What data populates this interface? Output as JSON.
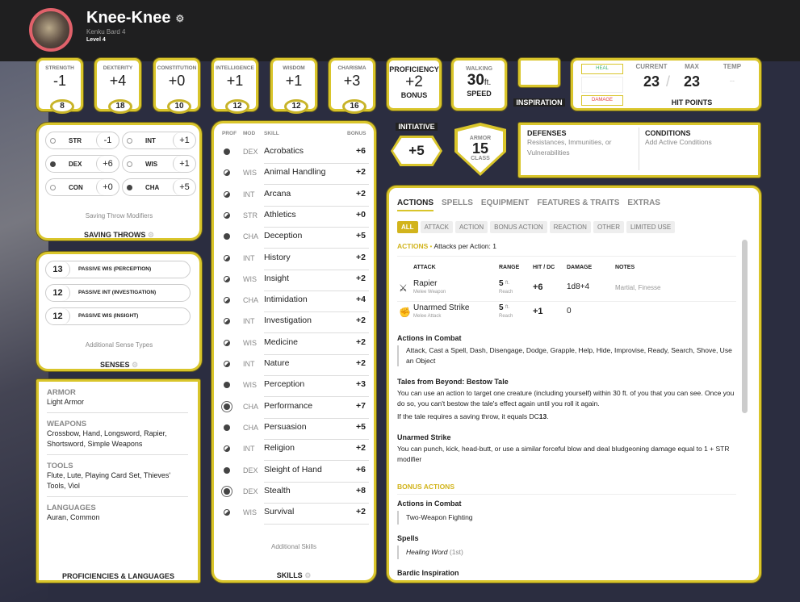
{
  "character": {
    "name": "Knee-Knee",
    "race_class": "Kenku  Bard 4",
    "level": "Level 4"
  },
  "abilities": [
    {
      "label": "STRENGTH",
      "mod": "-1",
      "score": "8"
    },
    {
      "label": "DEXTERITY",
      "mod": "+4",
      "score": "18"
    },
    {
      "label": "CONSTITUTION",
      "mod": "+0",
      "score": "10"
    },
    {
      "label": "INTELLIGENCE",
      "mod": "+1",
      "score": "12"
    },
    {
      "label": "WISDOM",
      "mod": "+1",
      "score": "12"
    },
    {
      "label": "CHARISMA",
      "mod": "+3",
      "score": "16"
    }
  ],
  "proficiency": {
    "top": "PROFICIENCY",
    "value": "+2",
    "bottom": "BONUS"
  },
  "speed": {
    "top": "WALKING",
    "value": "30",
    "unit": "ft.",
    "bottom": "SPEED"
  },
  "inspiration": {
    "label": "INSPIRATION"
  },
  "hp": {
    "heal": "HEAL",
    "damage": "DAMAGE",
    "current_label": "CURRENT",
    "max_label": "MAX",
    "temp_label": "TEMP",
    "current": "23",
    "sep": "/",
    "max": "23",
    "temp": "--",
    "title": "HIT POINTS"
  },
  "initiative": {
    "label": "INITIATIVE",
    "value": "+5"
  },
  "armor": {
    "top": "ARMOR",
    "value": "15",
    "bottom": "CLASS"
  },
  "defenses": {
    "title": "DEFENSES",
    "text": "Resistances, Immunities, or Vulnerabilities"
  },
  "conditions": {
    "title": "CONDITIONS",
    "text": "Add Active Conditions"
  },
  "saving_throws": {
    "title": "SAVING THROWS",
    "note": "Saving Throw Modifiers",
    "items": [
      {
        "ab": "STR",
        "v": "-1",
        "prof": false
      },
      {
        "ab": "INT",
        "v": "+1",
        "prof": false
      },
      {
        "ab": "DEX",
        "v": "+6",
        "prof": true
      },
      {
        "ab": "WIS",
        "v": "+1",
        "prof": false
      },
      {
        "ab": "CON",
        "v": "+0",
        "prof": false
      },
      {
        "ab": "CHA",
        "v": "+5",
        "prof": true
      }
    ]
  },
  "senses": {
    "title": "SENSES",
    "note": "Additional Sense Types",
    "items": [
      {
        "v": "13",
        "t": "PASSIVE WIS (PERCEPTION)"
      },
      {
        "v": "12",
        "t": "PASSIVE INT (INVESTIGATION)"
      },
      {
        "v": "12",
        "t": "PASSIVE WIS (INSIGHT)"
      }
    ]
  },
  "proficiencies": {
    "title": "PROFICIENCIES & LANGUAGES",
    "groups": [
      {
        "h": "ARMOR",
        "v": "Light Armor"
      },
      {
        "h": "WEAPONS",
        "v": "Crossbow, Hand, Longsword, Rapier, Shortsword, Simple Weapons"
      },
      {
        "h": "TOOLS",
        "v": "Flute, Lute, Playing Card Set, Thieves' Tools, Viol"
      },
      {
        "h": "LANGUAGES",
        "v": "Auran, Common"
      }
    ]
  },
  "skills": {
    "title": "SKILLS",
    "note": "Additional Skills",
    "headers": [
      "PROF",
      "MOD",
      "SKILL",
      "BONUS"
    ],
    "items": [
      {
        "p": "full",
        "m": "DEX",
        "n": "Acrobatics",
        "b": "+6"
      },
      {
        "p": "half",
        "m": "WIS",
        "n": "Animal Handling",
        "b": "+2"
      },
      {
        "p": "half",
        "m": "INT",
        "n": "Arcana",
        "b": "+2"
      },
      {
        "p": "half",
        "m": "STR",
        "n": "Athletics",
        "b": "+0"
      },
      {
        "p": "full",
        "m": "CHA",
        "n": "Deception",
        "b": "+5"
      },
      {
        "p": "half",
        "m": "INT",
        "n": "History",
        "b": "+2"
      },
      {
        "p": "half",
        "m": "WIS",
        "n": "Insight",
        "b": "+2"
      },
      {
        "p": "half",
        "m": "CHA",
        "n": "Intimidation",
        "b": "+4"
      },
      {
        "p": "half",
        "m": "INT",
        "n": "Investigation",
        "b": "+2"
      },
      {
        "p": "half",
        "m": "WIS",
        "n": "Medicine",
        "b": "+2"
      },
      {
        "p": "half",
        "m": "INT",
        "n": "Nature",
        "b": "+2"
      },
      {
        "p": "full",
        "m": "WIS",
        "n": "Perception",
        "b": "+3"
      },
      {
        "p": "exp",
        "m": "CHA",
        "n": "Performance",
        "b": "+7"
      },
      {
        "p": "full",
        "m": "CHA",
        "n": "Persuasion",
        "b": "+5"
      },
      {
        "p": "half",
        "m": "INT",
        "n": "Religion",
        "b": "+2"
      },
      {
        "p": "full",
        "m": "DEX",
        "n": "Sleight of Hand",
        "b": "+6"
      },
      {
        "p": "exp",
        "m": "DEX",
        "n": "Stealth",
        "b": "+8"
      },
      {
        "p": "half",
        "m": "WIS",
        "n": "Survival",
        "b": "+2"
      }
    ]
  },
  "actions_panel": {
    "tabs": [
      "ACTIONS",
      "SPELLS",
      "EQUIPMENT",
      "FEATURES & TRAITS",
      "EXTRAS"
    ],
    "filters": [
      "ALL",
      "ATTACK",
      "ACTION",
      "BONUS ACTION",
      "REACTION",
      "OTHER",
      "LIMITED USE"
    ],
    "actions_label": "ACTIONS",
    "attacks_per_action": "Attacks per Action: 1",
    "attack_headers": [
      "ATTACK",
      "RANGE",
      "HIT / DC",
      "DAMAGE",
      "NOTES"
    ],
    "attacks": [
      {
        "icon": "crossed-swords-icon",
        "name": "Rapier",
        "type": "Melee Weapon",
        "range": "5",
        "range_unit": "ft.",
        "range_sub": "Reach",
        "hit": "+6",
        "damage": "1d8+4",
        "notes": "Martial, Finesse"
      },
      {
        "icon": "fist-icon",
        "name": "Unarmed Strike",
        "type": "Melee Attack",
        "range": "5",
        "range_unit": "ft.",
        "range_sub": "Reach",
        "hit": "+1",
        "damage": "0",
        "notes": ""
      }
    ],
    "combat_title": "Actions in Combat",
    "combat_list": "Attack, Cast a Spell, Dash, Disengage, Dodge, Grapple, Help, Hide, Improvise, Ready, Search, Shove, Use an Object",
    "tale_title": "Tales from Beyond: Bestow Tale",
    "tale_text": "You can use an action to target one creature (including yourself) within 30 ft. of you that you can see. Once you do so, you can't bestow the tale's effect again until you roll it again.",
    "tale_dc_pre": "If the tale requires a saving throw, it equals DC",
    "tale_dc": "13",
    "tale_dc_post": ".",
    "unarmed_title": "Unarmed Strike",
    "unarmed_text": "You can punch, kick, head-butt, or use a similar forceful blow and deal bludgeoning damage equal to 1 + STR modifier",
    "bonus_label": "BONUS ACTIONS",
    "bonus_combat_title": "Actions in Combat",
    "bonus_combat": "Two-Weapon Fighting",
    "spells_title": "Spells",
    "spell": "Healing Word",
    "spell_level": "(1st)",
    "bardic_title": "Bardic Inspiration"
  },
  "colors": {
    "accent": "#d9c52b",
    "background": "#2b2d40",
    "header": "#1f1f20",
    "heal": "#3cb371",
    "damage": "#e04040"
  }
}
